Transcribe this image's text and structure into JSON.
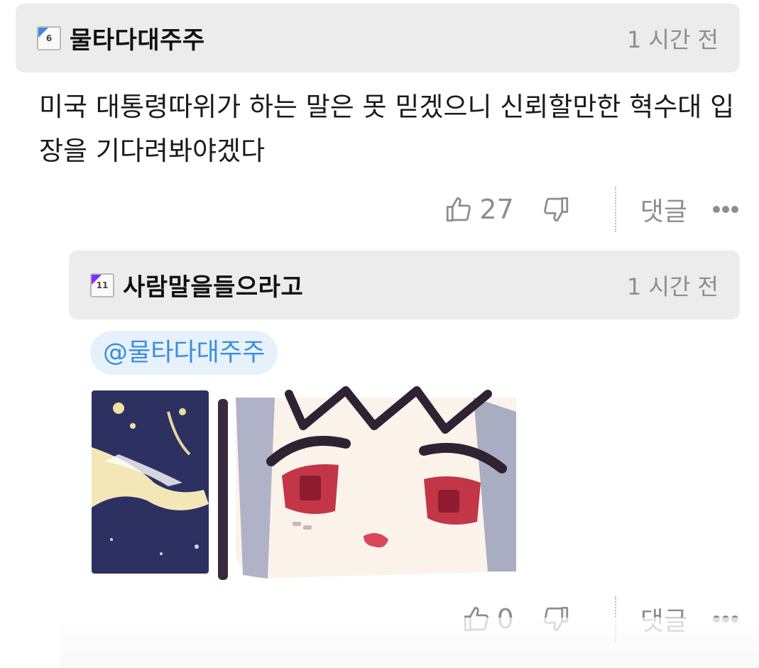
{
  "comments": [
    {
      "author": "물타다대주주",
      "level_badge": "6",
      "badge_color": "#3d8be0",
      "time": "1 시간 전",
      "text": "미국 대통령따위가 하는 말은 못 믿겠으니 신뢰할만한 혁수대 입장을 기다려봐야겠다",
      "likes": "27",
      "reply_label": "댓글"
    },
    {
      "author": "사람말을들으라고",
      "level_badge": "11",
      "badge_color": "#7b2ff7",
      "time": "1 시간 전",
      "mention": "@물타다대주주",
      "attachment": "sticker-image",
      "likes": "0",
      "reply_label": "댓글"
    }
  ],
  "icons": {
    "like": "thumbs-up-icon",
    "dislike": "thumbs-down-icon",
    "more": "more-dots-icon"
  },
  "colors": {
    "header_bg": "#ececec",
    "mention_text": "#3a8ee0",
    "mention_bg": "#e7f1fb",
    "muted": "#8e8e8e"
  }
}
